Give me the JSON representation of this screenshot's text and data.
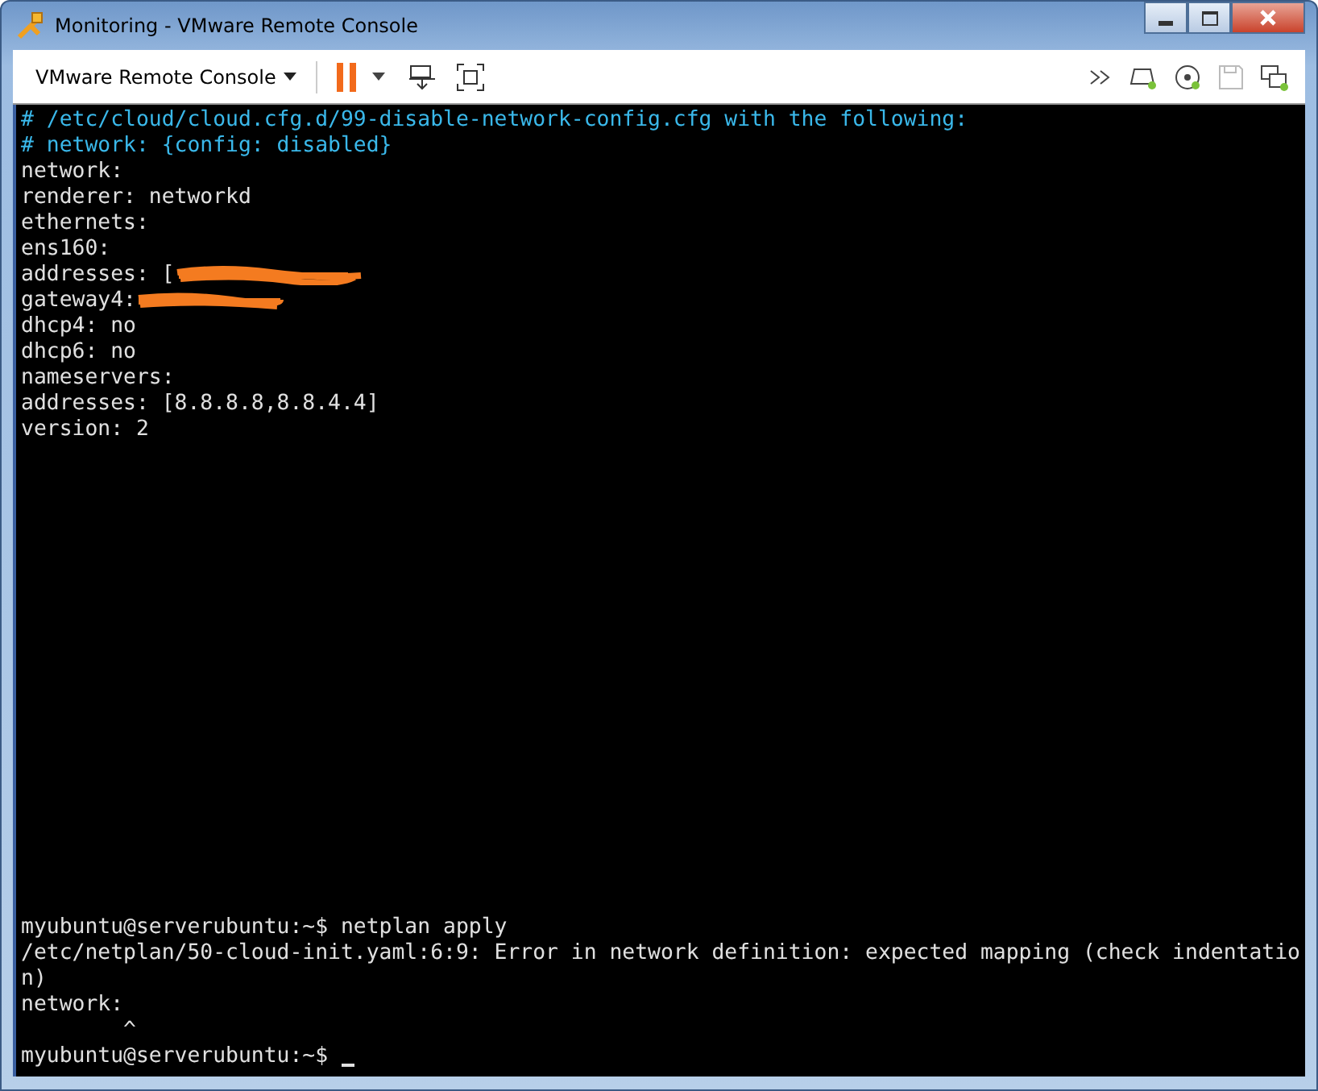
{
  "window": {
    "title": "Monitoring - VMware Remote Console"
  },
  "toolbar": {
    "menu_label": "VMware Remote Console"
  },
  "console": {
    "top_lines": [
      {
        "text": "# /etc/cloud/cloud.cfg.d/99-disable-network-config.cfg with the following:",
        "kind": "comment"
      },
      {
        "text": "# network: {config: disabled}",
        "kind": "comment"
      },
      {
        "text": "network:",
        "kind": "plain"
      },
      {
        "text": "renderer: networkd",
        "kind": "plain"
      },
      {
        "text": "ethernets:",
        "kind": "plain"
      },
      {
        "text": "ens160:",
        "kind": "plain"
      },
      {
        "text": "addresses: [",
        "kind": "redacted"
      },
      {
        "text": "gateway4:",
        "kind": "redacted"
      },
      {
        "text": "dhcp4: no",
        "kind": "plain"
      },
      {
        "text": "dhcp6: no",
        "kind": "plain"
      },
      {
        "text": "nameservers:",
        "kind": "plain"
      },
      {
        "text": "addresses: [8.8.8.8,8.8.4.4]",
        "kind": "plain"
      },
      {
        "text": "version: 2",
        "kind": "plain"
      }
    ],
    "bottom_lines": [
      {
        "text": "myubuntu@serverubuntu:~$ netplan apply",
        "kind": "plain"
      },
      {
        "text": "/etc/netplan/50-cloud-init.yaml:6:9: Error in network definition: expected mapping (check indentatio",
        "kind": "plain"
      },
      {
        "text": "n)",
        "kind": "plain"
      },
      {
        "text": "network:",
        "kind": "plain"
      },
      {
        "text": "        ^",
        "kind": "plain"
      },
      {
        "text": "myubuntu@serverubuntu:~$ ",
        "kind": "prompt"
      }
    ]
  }
}
